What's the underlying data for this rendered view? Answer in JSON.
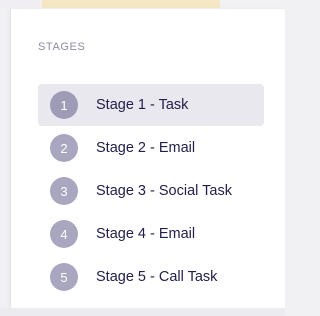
{
  "panel": {
    "title": "STAGES",
    "stages": [
      {
        "number": "1",
        "label": "Stage 1 - Task",
        "active": true
      },
      {
        "number": "2",
        "label": "Stage 2 - Email",
        "active": false
      },
      {
        "number": "3",
        "label": "Stage 3 - Social Task",
        "active": false
      },
      {
        "number": "4",
        "label": "Stage 4 - Email",
        "active": false
      },
      {
        "number": "5",
        "label": "Stage 5 - Call Task",
        "active": false
      }
    ]
  },
  "colors": {
    "active_row_bg": "#e9e8ef",
    "badge_bg": "#a9a7bf",
    "label_text": "#23204a",
    "title_text": "#8e8ca2"
  }
}
